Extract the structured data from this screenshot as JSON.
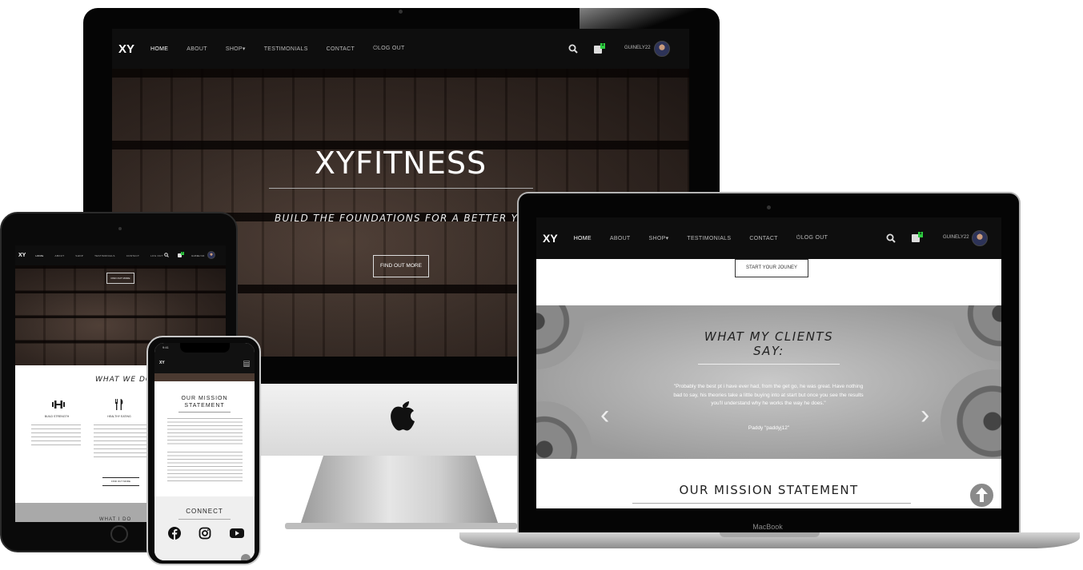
{
  "site": {
    "logo": "XY",
    "nav": [
      "HOME",
      "ABOUT",
      "SHOP",
      "TESTIMONIALS",
      "CONTACT",
      "LOG OUT"
    ],
    "shop_caret": "▾",
    "cart_count": "1",
    "username": "GUINELY22"
  },
  "desktop": {
    "hero_title": "XYFITNESS",
    "hero_tagline": "BUILD THE FOUNDATIONS FOR A BETTER YO",
    "hero_button": "FIND OUT MORE"
  },
  "laptop": {
    "start_button": "START YOUR JOUNEY",
    "testimonials_heading_line1": "WHAT MY CLIENTS",
    "testimonials_heading_line2": "SAY:",
    "testimonial_quote": "\"Probably the best pt i have ever had, from the get go, he was great. Have nothing bad to say, his theories take a little buying into at start but once you see the results you'll understand why he works the way he does.\"",
    "testimonial_author": "Paddy \"paddyj12\"",
    "prev_arrow": "‹",
    "next_arrow": "›",
    "mission_heading": "OUR MISSION STATEMENT",
    "brand_label": "MacBook"
  },
  "tablet": {
    "hero_button": "FIND OUT MORE",
    "section_heading": "WHAT WE DO",
    "feature1_title": "BUILD STRENGTH",
    "feature2_title": "HEALTHY EATING",
    "more_button": "FIND OUT MORE",
    "next_heading": "WHAT I DO"
  },
  "phone": {
    "time": "9:41",
    "logo": "XY",
    "mission_heading": "OUR MISSION STATEMENT",
    "connect_heading": "CONNECT"
  },
  "colors": {
    "nav_bg": "#0e0e0e",
    "badge": "#2ecc40",
    "scroll_top": "#8a8a8a"
  },
  "icons": [
    "search-icon",
    "shopping-bag-icon",
    "avatar",
    "apple-logo-icon",
    "dumbbell-icon",
    "fork-knife-icon",
    "facebook-icon",
    "instagram-icon",
    "youtube-icon",
    "arrow-up-icon",
    "chevron-left-icon",
    "chevron-right-icon",
    "menu-icon"
  ]
}
